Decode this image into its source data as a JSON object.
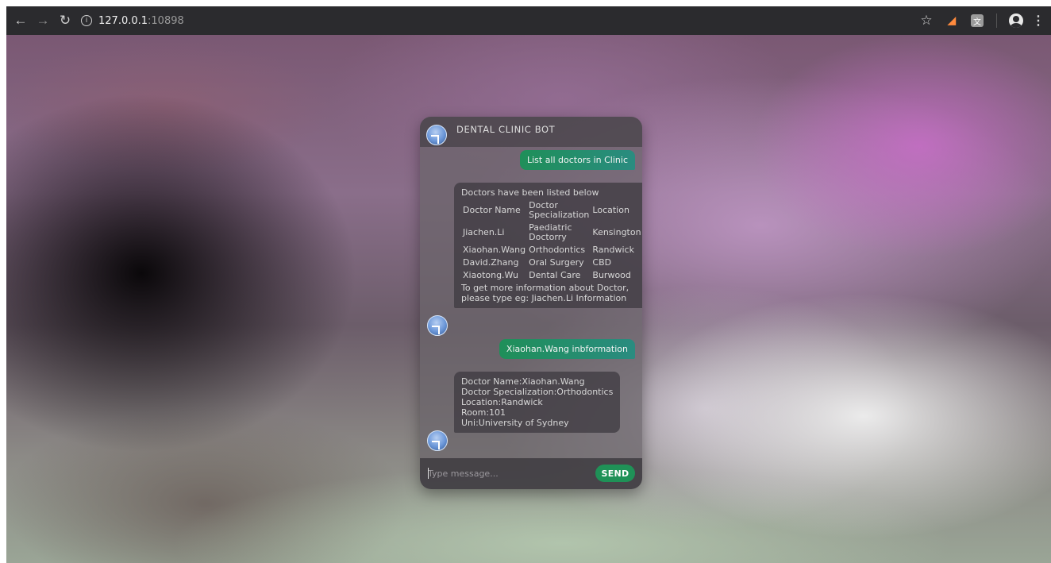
{
  "browser": {
    "url_host": "127.0.0.1",
    "url_port": ":10898",
    "back_icon": "arrow-left",
    "forward_icon": "arrow-right",
    "reload_icon": "reload",
    "bookmark_icon": "star",
    "menu_icon": "kebab"
  },
  "chat": {
    "title": "DENTAL CLINIC BOT",
    "messages": [
      {
        "from": "user",
        "text": "List all doctors in Clinic"
      },
      {
        "from": "bot",
        "intro": "Doctors have been listed below",
        "table": {
          "headers": [
            "Doctor Name",
            "Doctor Specialization",
            "Location"
          ],
          "rows": [
            [
              "Jiachen.Li",
              "Paediatric Doctorry",
              "Kensington"
            ],
            [
              "Xiaohan.Wang",
              "Orthodontics",
              "Randwick"
            ],
            [
              "David.Zhang",
              "Oral Surgery",
              "CBD"
            ],
            [
              "Xiaotong.Wu",
              "Dental Care",
              "Burwood"
            ]
          ]
        },
        "outro": "To get more information about Doctor, please type eg: Jiachen.Li Information"
      },
      {
        "from": "user",
        "text": "Xiaohan.Wang inbformation"
      },
      {
        "from": "bot",
        "lines": [
          "Doctor Name:Xiaohan.Wang",
          "Doctor Specialization:Orthodontics",
          "Location:Randwick",
          "Room:101",
          "Uni:University of Sydney"
        ]
      }
    ],
    "input_placeholder": "Type message...",
    "send_label": "SEND"
  },
  "colors": {
    "user_bubble": "#1f8f59",
    "send_button": "#1f9157"
  }
}
